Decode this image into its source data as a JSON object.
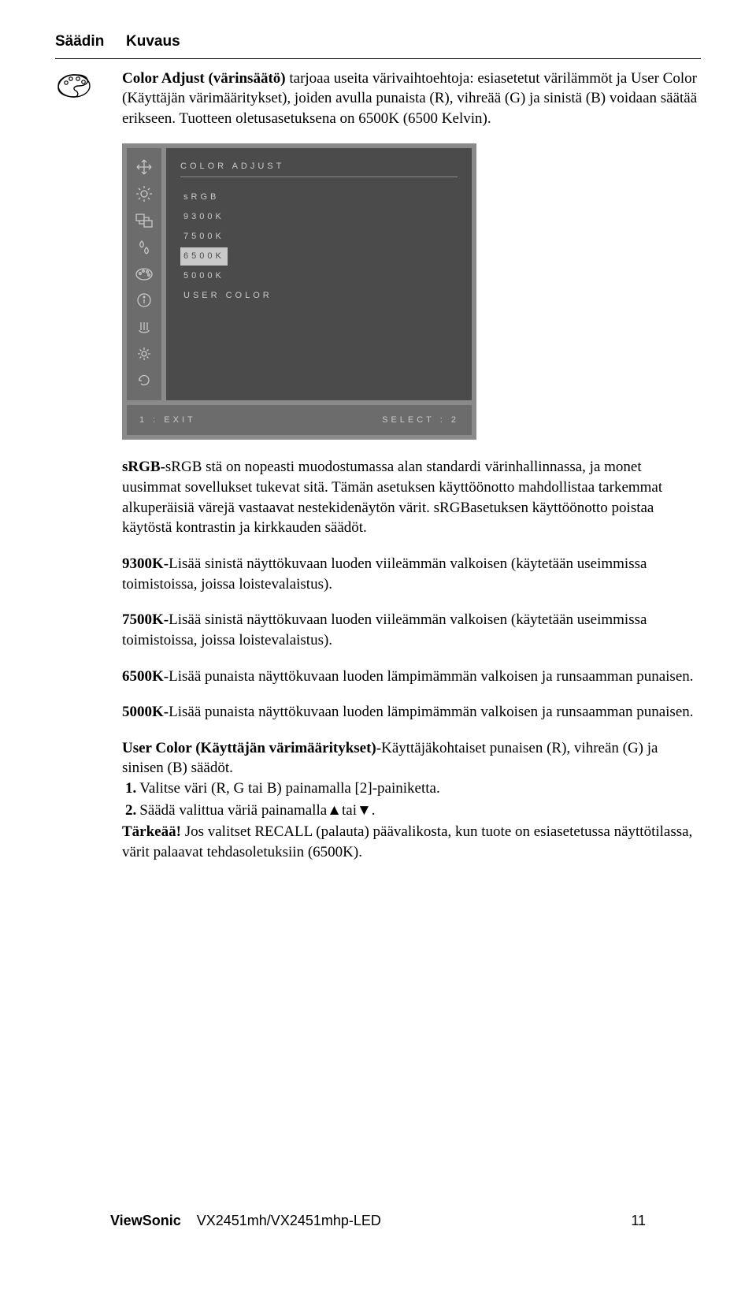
{
  "header": {
    "left": "Säädin",
    "right": "Kuvaus"
  },
  "intro": {
    "bold": "Color Adjust (värinsäätö)",
    "rest": " tarjoaa useita värivaihtoehtoja: esiasetetut värilämmöt ja User Color (Käyttäjän värimääritykset), joiden avulla punaista (R), vihreää (G) ja sinistä (B) voidaan säätää erikseen. Tuotteen oletusasetuksena on 6500K (6500 Kelvin)."
  },
  "osd": {
    "title": "COLOR ADJUST",
    "items": [
      "sRGB",
      "9300K",
      "7500K",
      "6500K",
      "5000K",
      "USER COLOR"
    ],
    "selected": "6500K",
    "exit": "1 : EXIT",
    "select": "SELECT : 2"
  },
  "srgb": {
    "bold": "sRGB-",
    "rest": "sRGB stä on nopeasti muodostumassa alan standardi värinhallinnassa, ja monet uusimmat sovellukset tukevat sitä. Tämän asetuksen käyttöönotto mahdollistaa tarkemmat alkuperäisiä värejä vastaavat nestekidenäytön värit. sRGBasetuksen käyttöönotto poistaa käytöstä kontrastin ja kirkkauden säädöt."
  },
  "k9300": {
    "bold": "9300K-",
    "rest": "Lisää sinistä näyttökuvaan luoden viileämmän valkoisen (käytetään useimmissa toimistoissa, joissa loistevalaistus)."
  },
  "k7500": {
    "bold": "7500K-",
    "rest": "Lisää sinistä näyttökuvaan luoden viileämmän valkoisen (käytetään useimmissa toimistoissa, joissa loistevalaistus)."
  },
  "k6500": {
    "bold": "6500K-",
    "rest": "Lisää punaista näyttökuvaan luoden lämpimämmän valkoisen ja runsaamman punaisen."
  },
  "k5000": {
    "bold": "5000K-",
    "rest": "Lisää punaista näyttökuvaan luoden lämpimämmän valkoisen ja runsaamman punaisen."
  },
  "usercolor": {
    "bold": "User Color (Käyttäjän värimääritykset)-",
    "rest": "Käyttäjäkohtaiset punaisen (R), vihreän (G) ja sinisen (B) säädöt.",
    "step1_num": "1.",
    "step1": "Valitse väri (R, G tai B) painamalla [2]-painiketta.",
    "step2_num": "2.",
    "step2_a": "Säädä valittua väriä painamalla",
    "step2_b": "tai",
    "step2_c": ".",
    "important_label": "Tärkeää!",
    "important_text": " Jos valitset RECALL (palauta) päävalikosta, kun tuote on esiasetetussa näyttötilassa, värit palaavat tehdasoletuksiin (6500K)."
  },
  "footer": {
    "brand": "ViewSonic",
    "model": "VX2451mh/VX2451mhp-LED",
    "page": "11"
  }
}
